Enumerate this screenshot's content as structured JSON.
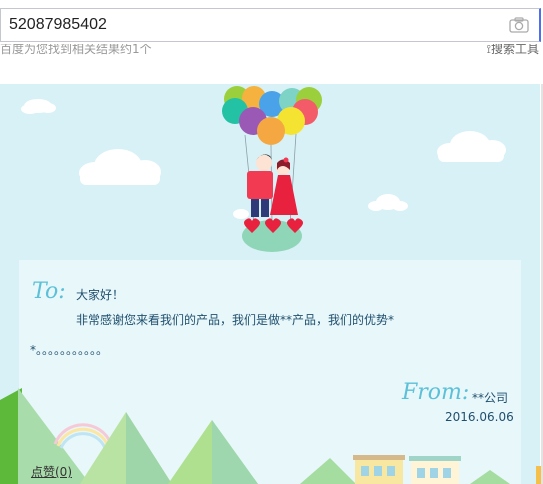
{
  "search": {
    "query": "52087985402"
  },
  "results": {
    "count_text": "百度为您找到相关结果约1个",
    "tools_label": "搜索工具"
  },
  "card": {
    "to_label": "To:",
    "greeting": "大家好！",
    "body_text": "非常感谢您来看我们的产品，我们是做**产品，我们的优势*",
    "dots_text": "*。。。。。。。。。。。",
    "from_label": "From:",
    "company": "**公司",
    "date": "2016.06.06"
  },
  "like": {
    "label": "点赞(0)"
  },
  "icons": [
    "camera-icon",
    "search-tools-icon"
  ],
  "colors": {
    "sky": "#d8f1f6",
    "letter_bg": "#e8f7fa",
    "accent_script": "#5bc0d8",
    "text": "#1f4f6e",
    "search_focus": "#4e6ef2"
  }
}
